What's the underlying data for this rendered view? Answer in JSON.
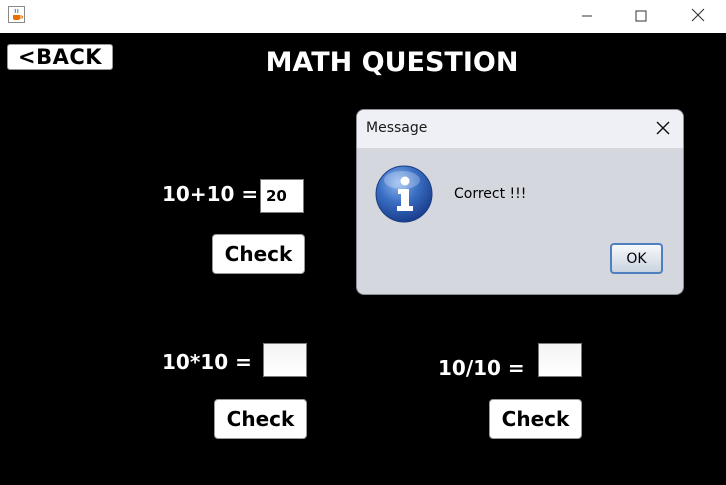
{
  "window": {
    "icon": "java-cup-icon",
    "controls": {
      "minimize": "minimize-icon",
      "maximize": "maximize-icon",
      "close": "close-icon"
    }
  },
  "header": {
    "back_label": "<BACK",
    "title": "MATH QUESTION"
  },
  "questions": [
    {
      "label": "10+10 =",
      "answer": "20",
      "check_label": "Check"
    },
    {
      "label": "10*10 =",
      "answer": "",
      "check_label": "Check"
    },
    {
      "label": "10/10 =",
      "answer": "",
      "check_label": "Check"
    }
  ],
  "dialog": {
    "title": "Message",
    "icon": "info-icon",
    "message": "Correct !!!",
    "ok_label": "OK"
  }
}
